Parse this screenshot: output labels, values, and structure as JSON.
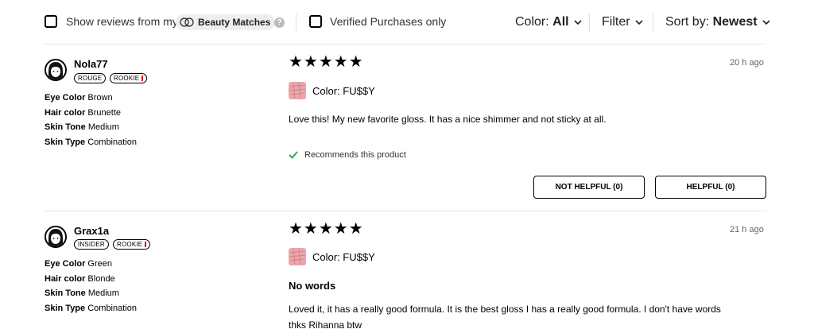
{
  "filters": {
    "show_reviews_label": "Show reviews from my",
    "beauty_matches_label": "Beauty Matches",
    "help_icon": "?",
    "verified_label": "Verified Purchases only",
    "color_prefix": "Color:",
    "color_value": "All",
    "filter_label": "Filter",
    "sort_prefix": "Sort by:",
    "sort_value": "Newest"
  },
  "reviews": [
    {
      "username": "Nola77",
      "badges": [
        "ROUGE",
        "ROOKIE"
      ],
      "attributes": [
        {
          "label": "Eye Color",
          "value": "Brown"
        },
        {
          "label": "Hair color",
          "value": "Brunette"
        },
        {
          "label": "Skin Tone",
          "value": "Medium"
        },
        {
          "label": "Skin Type",
          "value": "Combination"
        }
      ],
      "rating": 5,
      "stars": "★★★★★",
      "time": "20 h ago",
      "color": "Color: FU$$Y",
      "text": "Love this! My new favorite gloss. It has a nice shimmer and not sticky at all.",
      "recommends": "Recommends this product",
      "not_helpful": "NOT HELPFUL (0)",
      "helpful": "HELPFUL (0)"
    },
    {
      "username": "Grax1a",
      "badges": [
        "INSIDER",
        "ROOKIE"
      ],
      "attributes": [
        {
          "label": "Eye Color",
          "value": "Green"
        },
        {
          "label": "Hair color",
          "value": "Blonde"
        },
        {
          "label": "Skin Tone",
          "value": "Medium"
        },
        {
          "label": "Skin Type",
          "value": "Combination"
        }
      ],
      "rating": 5,
      "stars": "★★★★★",
      "time": "21 h ago",
      "color": "Color: FU$$Y",
      "headline": "No words",
      "text_line1": "Loved it, it has a really good formula. It is the best gloss I has a really good formula. I don't have words",
      "text_line2": "thks Rihanna btw"
    }
  ],
  "colors": {
    "swatch": "#e8a7ad",
    "check_green": "#3aa655",
    "badge_red": "#d0021b"
  }
}
